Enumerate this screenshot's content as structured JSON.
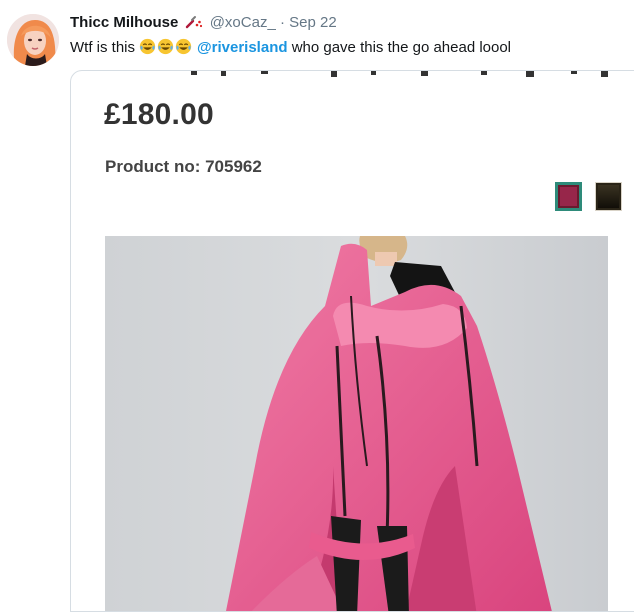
{
  "tweet": {
    "display_name": "Thicc Milhouse",
    "badge_icon": "nail-polish-icon",
    "handle": "@xoCaz_",
    "separator": "·",
    "date": "Sep 22",
    "text_before": "Wtf is this",
    "emojis": [
      "face-with-tears-of-joy-icon",
      "face-with-tears-of-joy-icon",
      "face-with-tears-of-joy-icon"
    ],
    "mention": "@riverisland",
    "text_after": "who gave this the go ahead loool",
    "mention_color": "#1b95e0"
  },
  "product": {
    "price": "£180.00",
    "product_number": "Product no: 705962",
    "swatches": [
      {
        "name": "pink",
        "color": "#97264a",
        "selected": true
      },
      {
        "name": "black",
        "color": "#1e1a10",
        "selected": false
      }
    ]
  }
}
